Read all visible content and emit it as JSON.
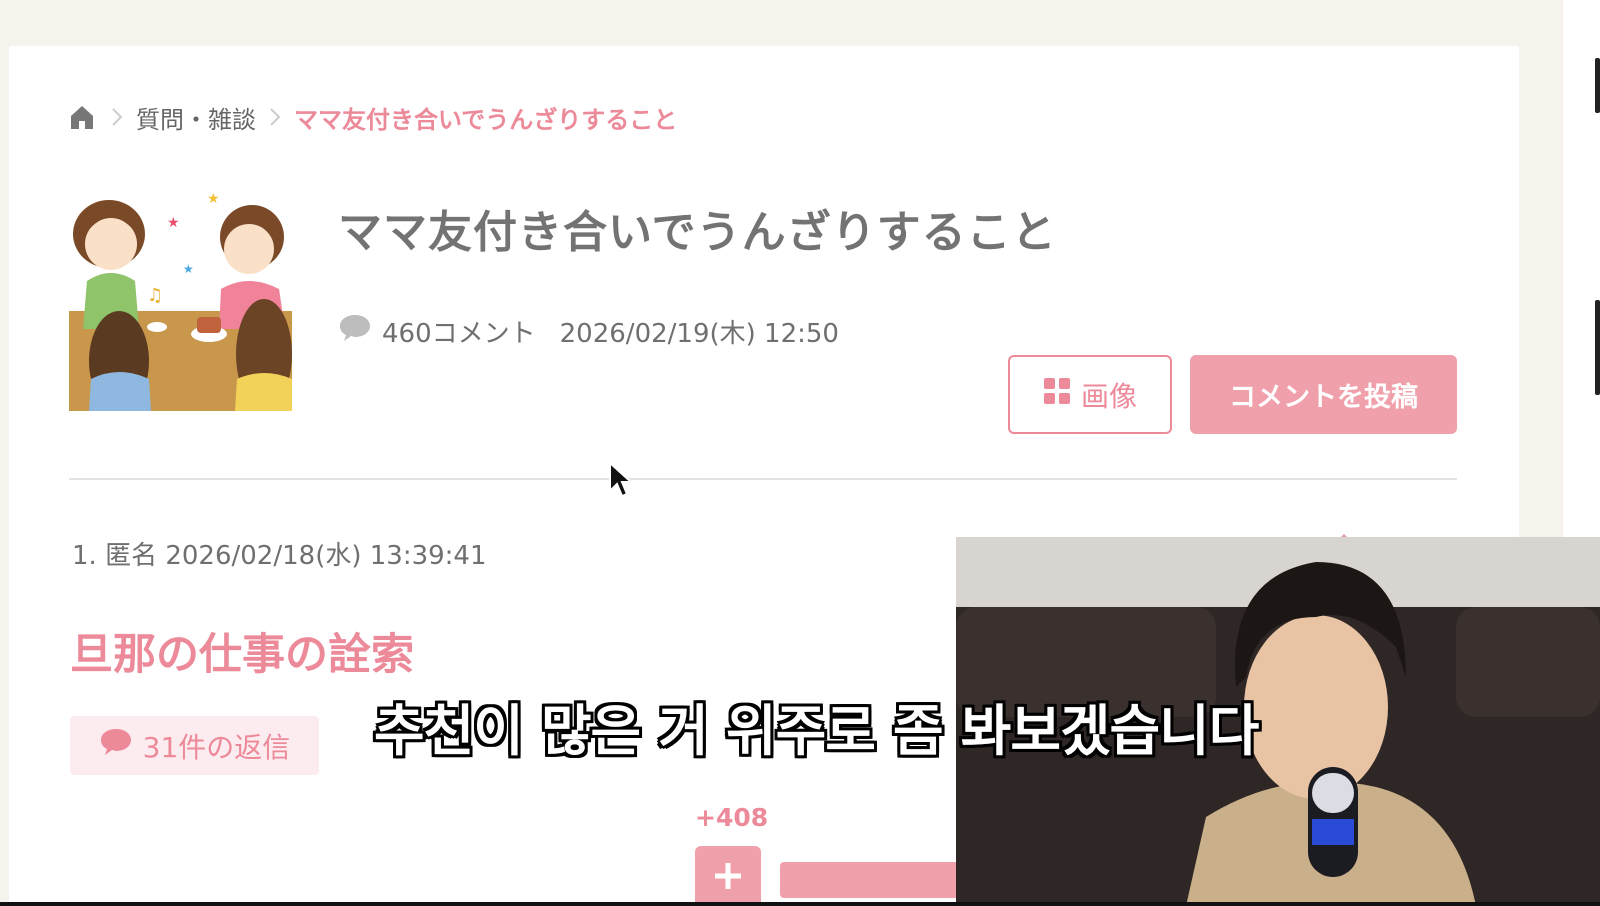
{
  "breadcrumb": {
    "home_icon": "home-icon",
    "items": [
      "質問・雑談",
      "ママ友付き合いでうんざりすること"
    ]
  },
  "thread": {
    "title": "ママ友付き合いでうんざりすること",
    "comment_count": "460コメント",
    "date": "2026/02/19(木) 12:50",
    "image_button_label": "画像",
    "post_button_label": "コメントを投稿"
  },
  "comment": {
    "meta": "1. 匿名 2026/02/18(水) 13:39:41",
    "title": "旦那の仕事の詮索",
    "replies": "31件の返信",
    "vote_count": "+408"
  },
  "subtitle": "추천이 많은 거 위주로 좀 봐보겠습니다",
  "colors": {
    "accent": "#ec8a9a",
    "button_fill": "#f0a0ab",
    "badge_bg": "#fdecef",
    "background": "#f6f2ec"
  }
}
